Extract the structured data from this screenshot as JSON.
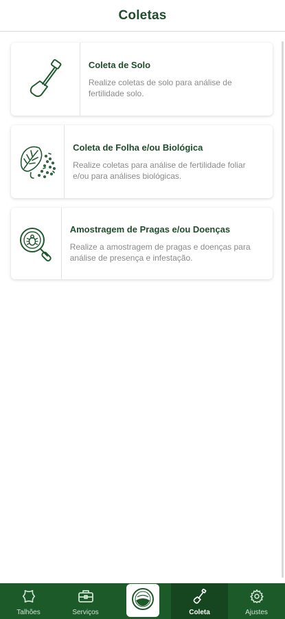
{
  "header": {
    "title": "Coletas"
  },
  "cards": [
    {
      "title": "Coleta de Solo",
      "description": "Realize coletas de solo para análise de fertilidade solo.",
      "icon": "shovel-icon"
    },
    {
      "title": "Coleta de Folha e/ou Biológica",
      "description": "Realize coletas para análise de fertilidade foliar e/ou para análises biológicas.",
      "icon": "leaf-icon"
    },
    {
      "title": "Amostragem de Pragas e/ou Doenças",
      "description": "Realize a amostragem de pragas e doenças para análise de presença e infestação.",
      "icon": "bug-magnifier-icon"
    }
  ],
  "nav": {
    "items": [
      {
        "label": "Talhões",
        "icon": "field-icon"
      },
      {
        "label": "Serviços",
        "icon": "briefcase-icon"
      },
      {
        "label": "",
        "icon": "logo-icon"
      },
      {
        "label": "Coleta",
        "icon": "shovel-icon"
      },
      {
        "label": "Ajustes",
        "icon": "gear-icon"
      }
    ],
    "active": "Coleta"
  },
  "colors": {
    "primary": "#1d5a2a",
    "title": "#1f4d2b",
    "muted": "#8a8a8a"
  }
}
